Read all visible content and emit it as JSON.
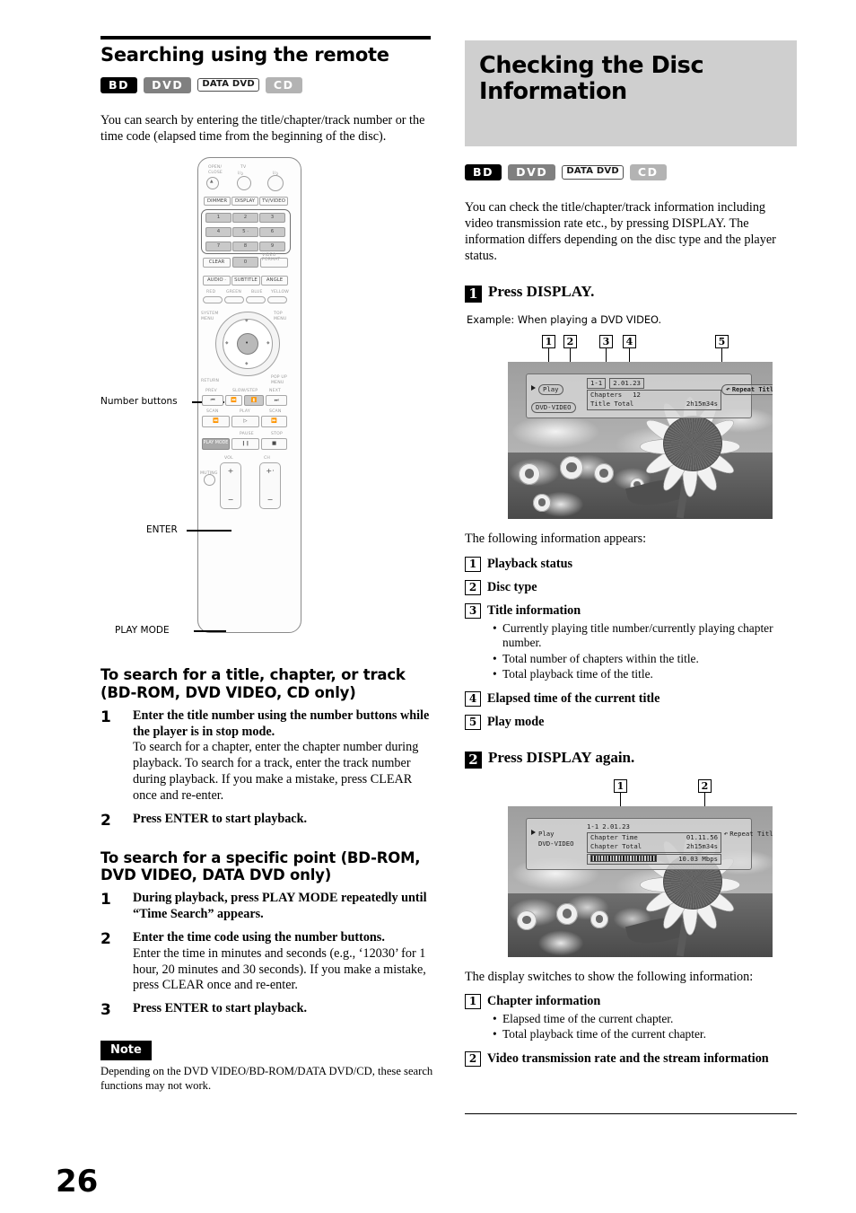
{
  "page": {
    "number": "26"
  },
  "left": {
    "section_title": "Searching using the remote",
    "badges": [
      {
        "id": "bd",
        "label": "BD"
      },
      {
        "id": "dvd",
        "label": "DVD"
      },
      {
        "id": "data",
        "label": "DATA DVD"
      },
      {
        "id": "cd",
        "label": "CD"
      }
    ],
    "intro": "You can search by entering the title/chapter/track number or the time code (elapsed time from the beginning of the disc).",
    "remote": {
      "callouts": [
        {
          "label": "Number buttons"
        },
        {
          "label": "ENTER"
        },
        {
          "label": "PLAY MODE"
        }
      ],
      "top_functions": [
        "OPEN/\nCLOSE",
        "TV\nI/⊕",
        "I/⊕"
      ],
      "row_dimmer": [
        "DIMMER",
        "DISPLAY",
        "TV/VIDEO"
      ],
      "numbers": [
        "1",
        "2",
        "3",
        "4",
        "5",
        "6",
        "7",
        "8",
        "9"
      ],
      "clear": "CLEAR",
      "zero": "0",
      "format": "VIDEO\nFORMAT",
      "row_audio": [
        "AUDIO",
        "SUBTITLE",
        "ANGLE"
      ],
      "color_keys": [
        "RED",
        "GREEN",
        "BLUE",
        "YELLOW"
      ],
      "system_menu": "SYSTEM\nMENU",
      "top_menu": "TOP\nMENU",
      "return": "RETURN",
      "popup_menu": "POP UP\nMENU",
      "transport_labels": [
        "PREV",
        "SLOW/STEP",
        "NEXT"
      ],
      "transport_labels2": [
        "SCAN",
        "PLAY",
        "SCAN"
      ],
      "transport_labels3": [
        "PAUSE",
        "STOP"
      ],
      "play_mode": "PLAY MODE",
      "vol": "VOL",
      "ch": "CH",
      "muting": "MUTING",
      "plus": "+",
      "minus": "−"
    },
    "sub1": {
      "title": "To search for a title, chapter, or track (BD-ROM, DVD VIDEO, CD only)",
      "steps": [
        {
          "num": "1",
          "lead": "Enter the title number using the number buttons while the player is in stop mode.",
          "body": "To search for a chapter, enter the chapter number during playback. To search for a track, enter the track number during playback. If you make a mistake, press CLEAR once and re-enter."
        },
        {
          "num": "2",
          "lead": "Press ENTER to start playback.",
          "body": ""
        }
      ]
    },
    "sub2": {
      "title": "To search for a specific point (BD-ROM, DVD VIDEO, DATA DVD only)",
      "steps": [
        {
          "num": "1",
          "lead": "During playback, press PLAY MODE repeatedly until “Time Search” appears.",
          "body": ""
        },
        {
          "num": "2",
          "lead": "Enter the time code using the number buttons.",
          "body": "Enter the time in minutes and seconds (e.g., ‘12030’ for 1 hour, 20 minutes and 30 seconds). If you make a mistake, press CLEAR once and re-enter."
        },
        {
          "num": "3",
          "lead": "Press ENTER to start playback.",
          "body": ""
        }
      ]
    },
    "note": {
      "tag": "Note",
      "text": "Depending on the DVD VIDEO/BD-ROM/DATA DVD/CD, these search functions may not work."
    }
  },
  "right": {
    "title": "Checking the Disc Information",
    "badges": [
      {
        "id": "bd",
        "label": "BD"
      },
      {
        "id": "dvd",
        "label": "DVD"
      },
      {
        "id": "data",
        "label": "DATA DVD"
      },
      {
        "id": "cd",
        "label": "CD"
      }
    ],
    "intro": "You can check the title/chapter/track information including video transmission rate etc., by pressing DISPLAY. The information differs depending on the disc type and the player status.",
    "step1": {
      "num": "1",
      "heading": "Press DISPLAY.",
      "example": "Example: When playing a DVD VIDEO.",
      "callouts": [
        "1",
        "2",
        "3",
        "4",
        "5"
      ],
      "osd": {
        "status": "Play",
        "disc_type": "DVD-VIDEO",
        "title_chapter": "1-1",
        "elapsed": "2.01.23",
        "chapters_label": "Chapters",
        "chapters_value": "12",
        "total_label": "Title Total",
        "total_value": "2h15m34s",
        "play_mode": "Repeat Title"
      },
      "lead": "The following information appears:",
      "items": [
        {
          "num": "1",
          "title": "Playback status",
          "bullets": []
        },
        {
          "num": "2",
          "title": "Disc type",
          "bullets": []
        },
        {
          "num": "3",
          "title": "Title information",
          "bullets": [
            "Currently playing title number/currently playing chapter number.",
            "Total number of chapters within the title.",
            "Total playback time of the title."
          ]
        },
        {
          "num": "4",
          "title": "Elapsed time of the current title",
          "bullets": []
        },
        {
          "num": "5",
          "title": "Play mode",
          "bullets": []
        }
      ]
    },
    "step2": {
      "num": "2",
      "heading": "Press DISPLAY again.",
      "callouts": [
        "1",
        "2"
      ],
      "osd": {
        "status": "Play",
        "disc_type": "DVD-VIDEO",
        "title_chapter": "1-1",
        "elapsed": "2.01.23",
        "chapter_time_label": "Chapter Time",
        "chapter_time_value": "01.11.56",
        "chapter_total_label": "Chapter Total",
        "chapter_total_value": "2h15m34s",
        "bitrate_value": "10.03 Mbps",
        "play_mode": "Repeat Title"
      },
      "lead": "The display switches to show the following information:",
      "items": [
        {
          "num": "1",
          "title": "Chapter information",
          "bullets": [
            "Elapsed time of the current chapter.",
            "Total playback time of the current chapter."
          ]
        },
        {
          "num": "2",
          "title": "Video transmission rate and the stream information",
          "bullets": []
        }
      ]
    }
  }
}
